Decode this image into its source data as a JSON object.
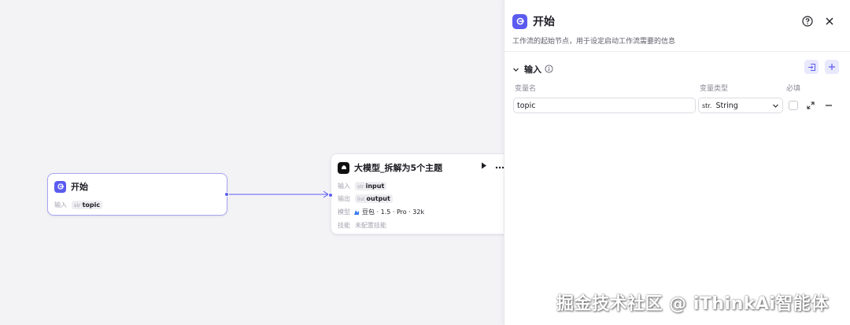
{
  "start_node": {
    "title": "开始",
    "input_label": "输入",
    "input_tag_type": "str",
    "input_tag_name": "topic"
  },
  "llm_node": {
    "title": "大模型_拆解为5个主题",
    "input_label": "输入",
    "input_tag_type": "str",
    "input_tag_name": "input",
    "output_label": "输出",
    "output_tag_type": "list",
    "output_tag_name": "output",
    "model_label": "模型",
    "model_value": "豆包 · 1.5 · Pro · 32k",
    "skill_label": "技能",
    "skill_value": "未配置技能",
    "run_icon": "play-icon",
    "more_icon": "more-icon"
  },
  "panel": {
    "title": "开始",
    "description": "工作流的起始节点，用于设定启动工作流需要的信息",
    "section_title": "输入",
    "columns": {
      "name": "变量名",
      "type": "变量类型",
      "required": "必填"
    },
    "rows": [
      {
        "name": "topic",
        "type_prefix": "str.",
        "type": "String",
        "required": false
      }
    ]
  },
  "watermark": "掘金技术社区 @ iThinkAi智能体",
  "colors": {
    "accent": "#5b5bf0",
    "canvas_bg": "#f3f3f6",
    "selected_border": "#a8a4f2"
  }
}
